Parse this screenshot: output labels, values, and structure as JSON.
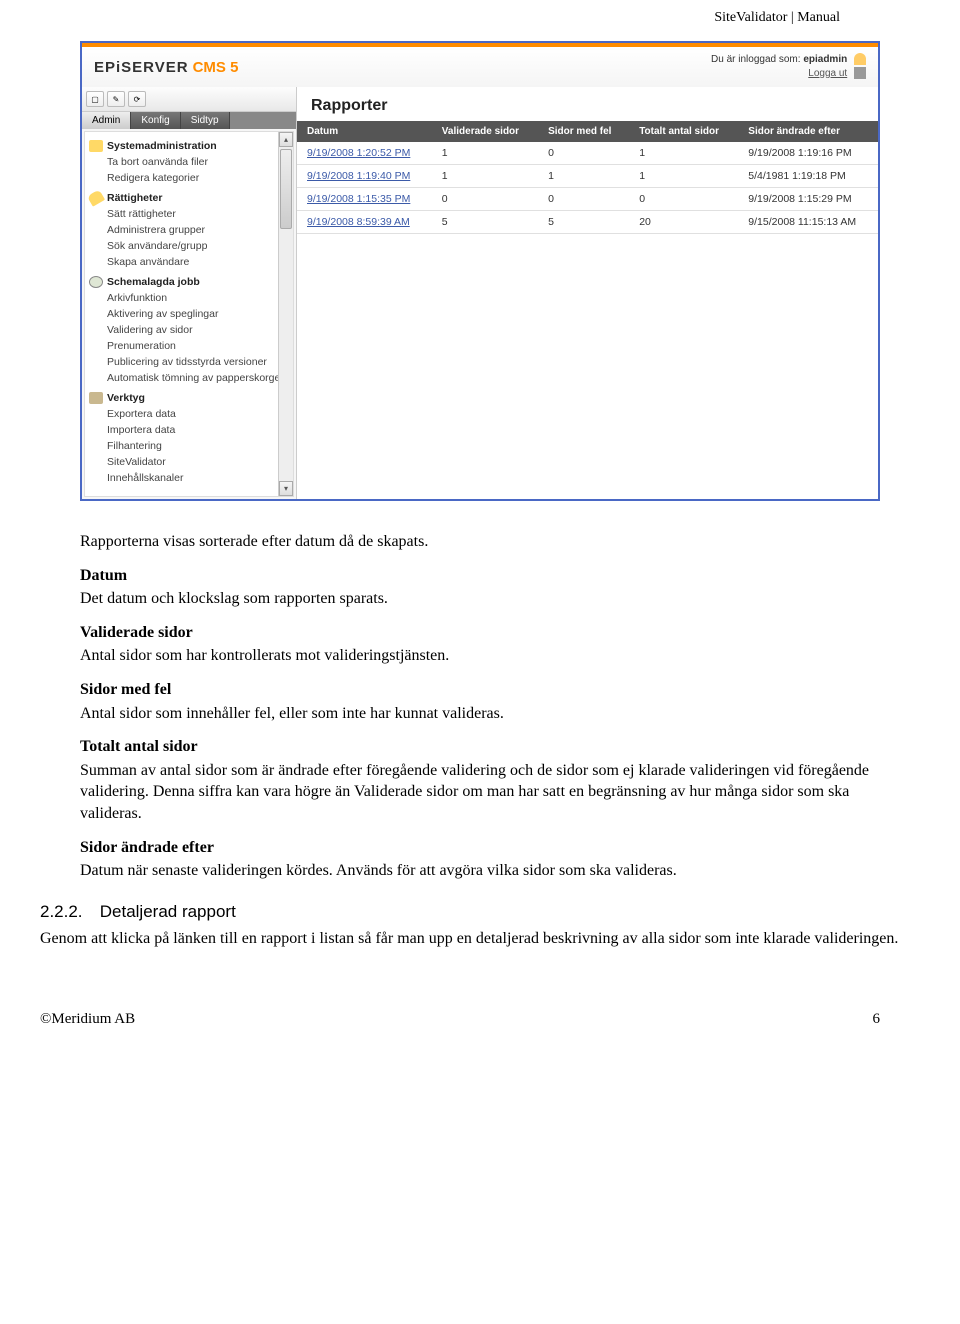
{
  "header_right": "SiteValidator | Manual",
  "screenshot": {
    "logo": {
      "brand": "EPiSERVER",
      "product": "CMS 5"
    },
    "login": {
      "logged_in_as_label": "Du är inloggad som:",
      "user": "epiadmin",
      "logout": "Logga ut"
    },
    "tabs": [
      "Admin",
      "Konfig",
      "Sidtyp"
    ],
    "tree": [
      {
        "title": "Systemadministration",
        "icon": "ico-wrench",
        "items": [
          "Ta bort oanvända filer",
          "Redigera kategorier"
        ]
      },
      {
        "title": "Rättigheter",
        "icon": "ico-key",
        "items": [
          "Sätt rättigheter",
          "Administrera grupper",
          "Sök användare/grupp",
          "Skapa användare"
        ]
      },
      {
        "title": "Schemalagda jobb",
        "icon": "ico-clock",
        "items": [
          "Arkivfunktion",
          "Aktivering av speglingar",
          "Validering av sidor",
          "Prenumeration",
          "Publicering av tidsstyrda versioner",
          "Automatisk tömning av papperskorgen"
        ]
      },
      {
        "title": "Verktyg",
        "icon": "ico-tools",
        "items": [
          "Exportera data",
          "Importera data",
          "Filhantering",
          "SiteValidator",
          "Innehållskanaler"
        ]
      }
    ],
    "main": {
      "title": "Rapporter",
      "columns": [
        "Datum",
        "Validerade sidor",
        "Sidor med fel",
        "Totalt antal sidor",
        "Sidor ändrade efter"
      ],
      "rows": [
        {
          "date": "9/19/2008 1:20:52 PM",
          "validated": "1",
          "errors": "0",
          "total": "1",
          "changed": "9/19/2008 1:19:16 PM"
        },
        {
          "date": "9/19/2008 1:19:40 PM",
          "validated": "1",
          "errors": "1",
          "total": "1",
          "changed": "5/4/1981 1:19:18 PM"
        },
        {
          "date": "9/19/2008 1:15:35 PM",
          "validated": "0",
          "errors": "0",
          "total": "0",
          "changed": "9/19/2008 1:15:29 PM"
        },
        {
          "date": "9/19/2008 8:59:39 AM",
          "validated": "5",
          "errors": "5",
          "total": "20",
          "changed": "9/15/2008 11:15:13 AM"
        }
      ]
    }
  },
  "paragraphs": {
    "intro": "Rapporterna visas sorterade efter datum då de skapats.",
    "datum_h": "Datum",
    "datum_b": "Det datum och klockslag som rapporten sparats.",
    "valid_h": "Validerade sidor",
    "valid_b": "Antal sidor som har kontrollerats mot valideringstjänsten.",
    "fel_h": "Sidor med fel",
    "fel_b": "Antal sidor som innehåller fel, eller som inte har kunnat valideras.",
    "tot_h": "Totalt antal sidor",
    "tot_b": "Summan av antal sidor som är ändrade efter föregående validering och de sidor som ej klarade valideringen vid föregående validering. Denna siffra kan vara högre än Validerade sidor om man har satt en begränsning av hur många sidor som ska valideras.",
    "aft_h": "Sidor ändrade efter",
    "aft_b": "Datum när senaste valideringen kördes. Används för att avgöra vilka sidor som ska valideras."
  },
  "section_222": {
    "num": "2.2.2.",
    "title": "Detaljerad rapport",
    "body": "Genom att klicka på länken till en rapport i listan så får man upp en detaljerad beskrivning av alla sidor som inte klarade valideringen."
  },
  "footer": {
    "left": "©Meridium AB",
    "right": "6"
  }
}
